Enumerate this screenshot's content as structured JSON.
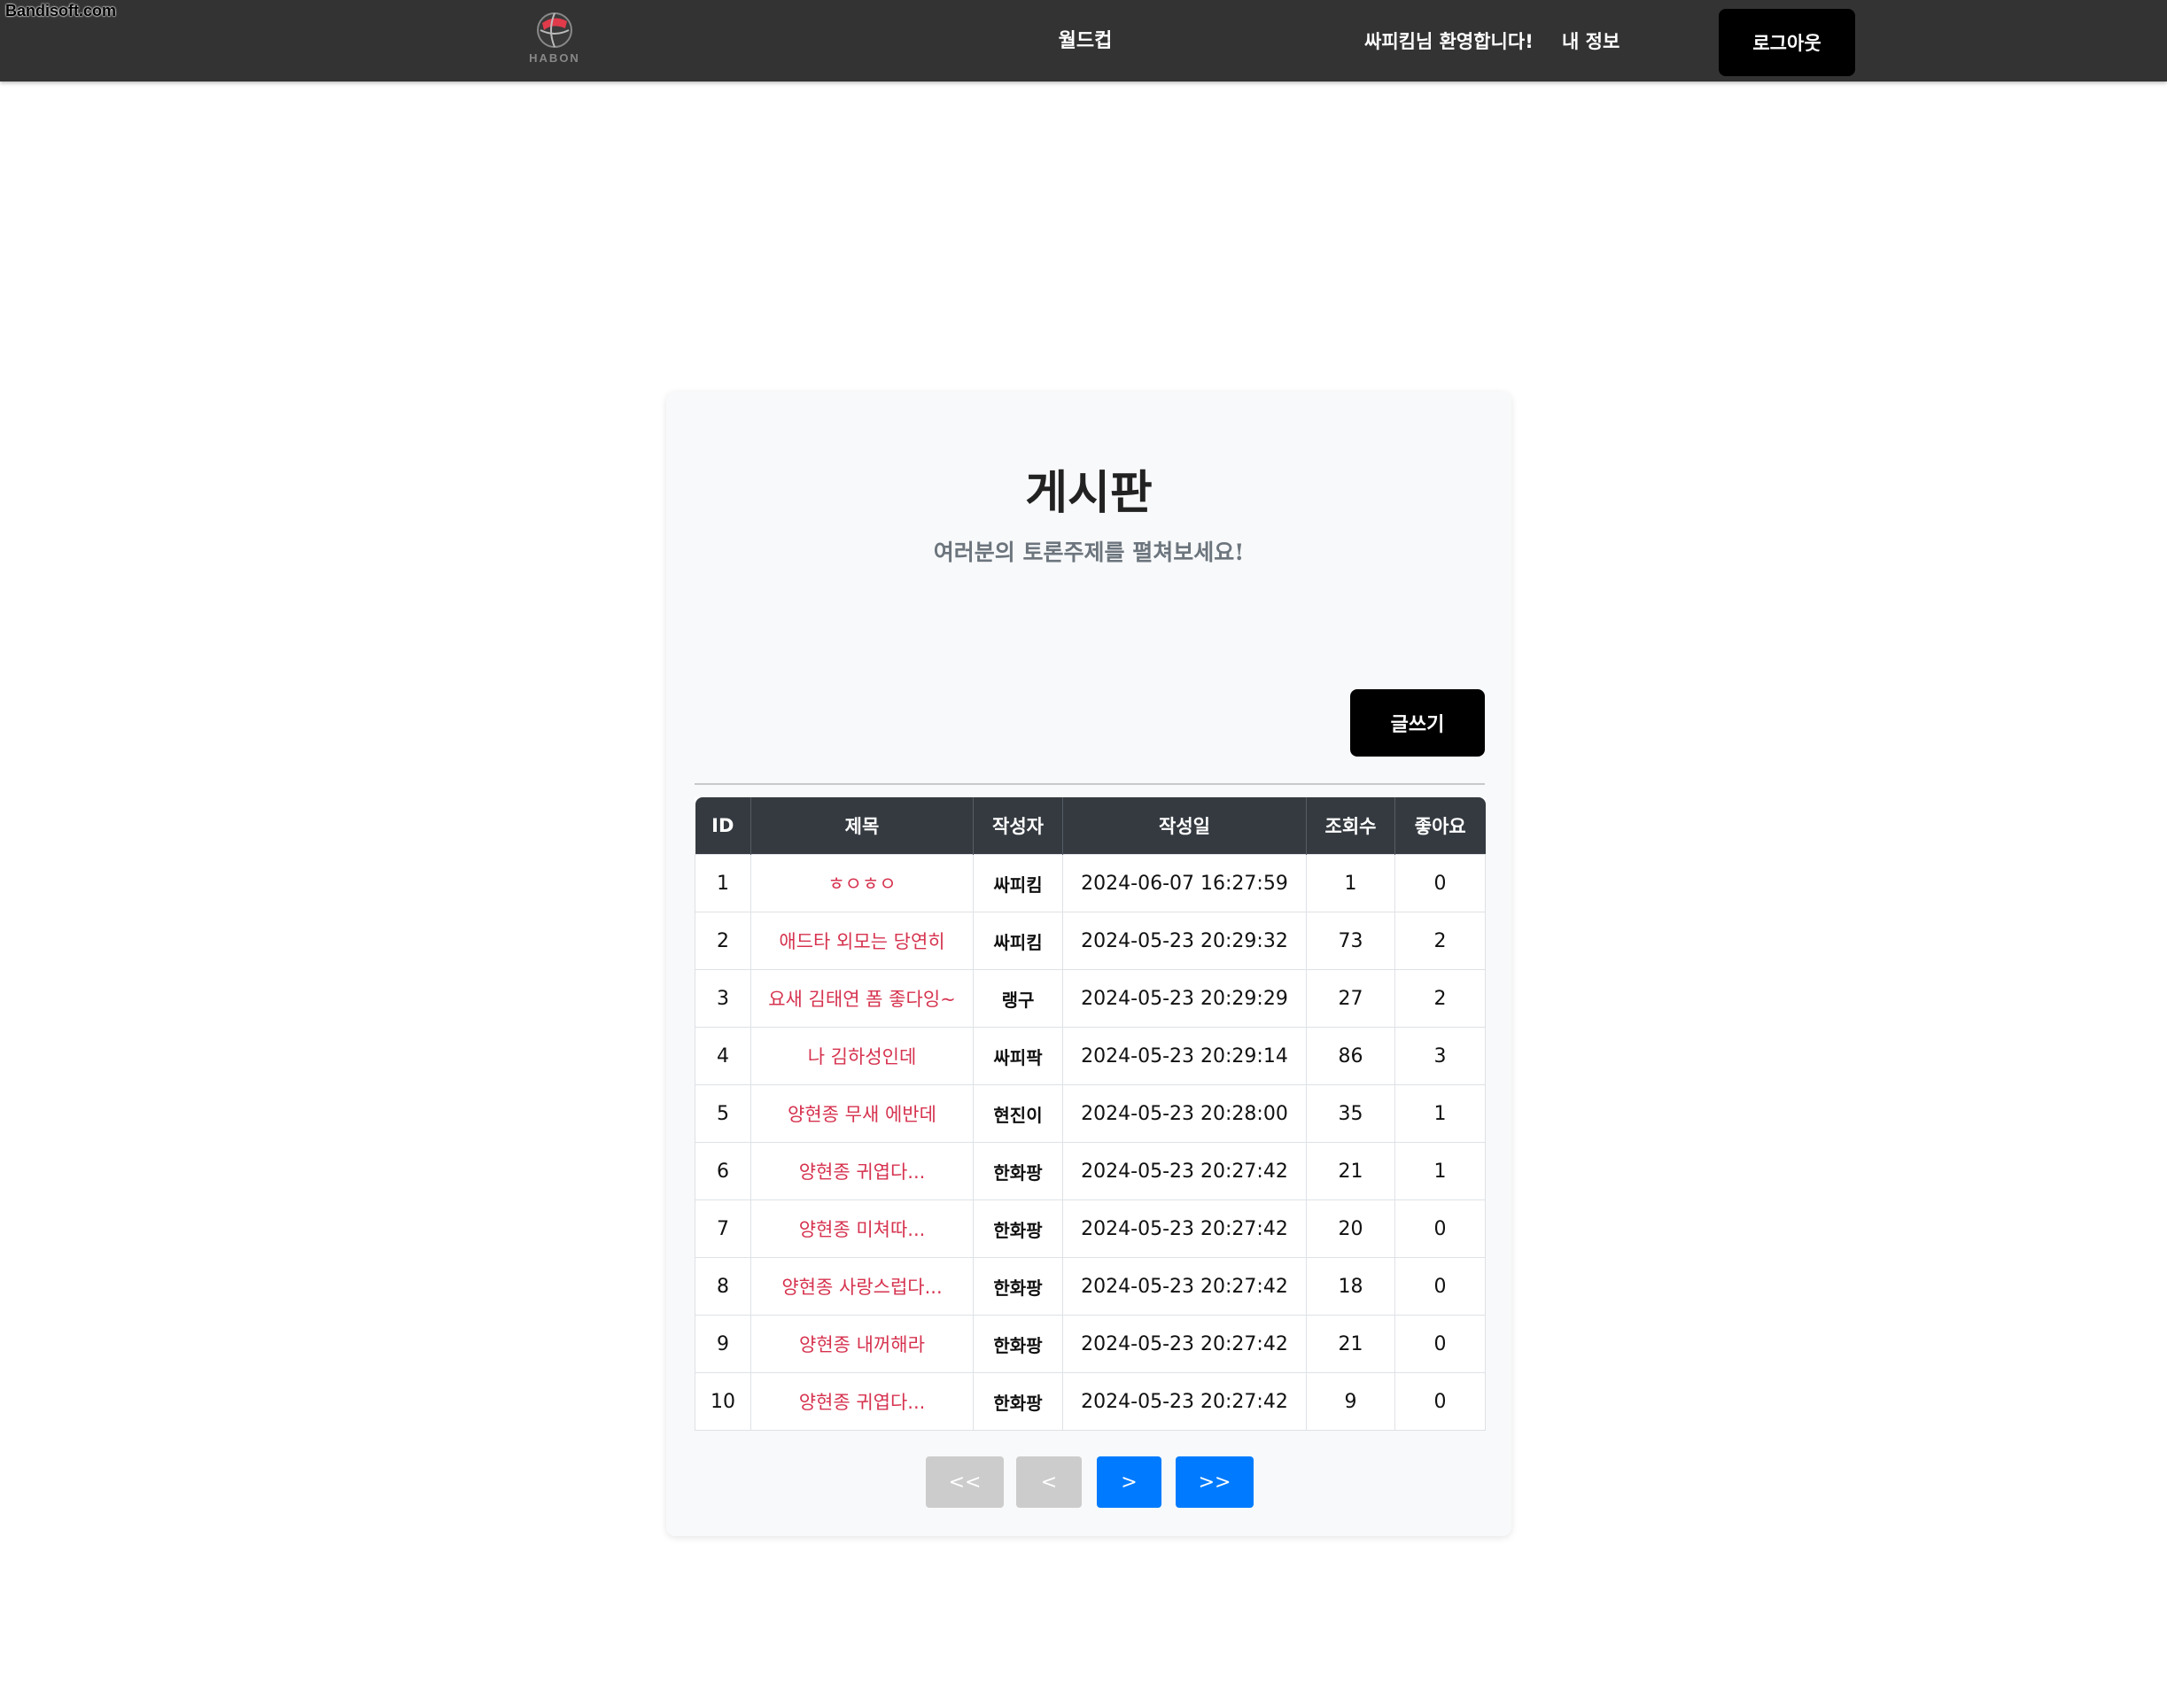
{
  "watermark": "Bandisoft.com",
  "navbar": {
    "logo_text": "HABON",
    "worldcup_label": "월드컵",
    "welcome_text": "싸피킴님 환영합니다!",
    "myinfo_label": "내 정보",
    "logout_label": "로그아웃"
  },
  "board": {
    "title": "게시판",
    "subtitle": "여러분의 토론주제를 펼쳐보세요!",
    "write_label": "글쓰기",
    "columns": [
      "ID",
      "제목",
      "작성자",
      "작성일",
      "조회수",
      "좋아요"
    ],
    "rows": [
      {
        "id": "1",
        "title": "ㅎㅇㅎㅇ",
        "author": "싸피킴",
        "date": "2024-06-07 16:27:59",
        "views": "1",
        "likes": "0"
      },
      {
        "id": "2",
        "title": "애드타 외모는 당연히",
        "author": "싸피킴",
        "date": "2024-05-23 20:29:32",
        "views": "73",
        "likes": "2"
      },
      {
        "id": "3",
        "title": "요새 김태연 폼 좋다잉~",
        "author": "랭구",
        "date": "2024-05-23 20:29:29",
        "views": "27",
        "likes": "2"
      },
      {
        "id": "4",
        "title": "나 김하성인데",
        "author": "싸피팍",
        "date": "2024-05-23 20:29:14",
        "views": "86",
        "likes": "3"
      },
      {
        "id": "5",
        "title": "양현종 무새 에반데",
        "author": "현진이",
        "date": "2024-05-23 20:28:00",
        "views": "35",
        "likes": "1"
      },
      {
        "id": "6",
        "title": "양현종 귀엽다...",
        "author": "한화팡",
        "date": "2024-05-23 20:27:42",
        "views": "21",
        "likes": "1"
      },
      {
        "id": "7",
        "title": "양현종 미쳐따...",
        "author": "한화팡",
        "date": "2024-05-23 20:27:42",
        "views": "20",
        "likes": "0"
      },
      {
        "id": "8",
        "title": "양현종 사랑스럽다...",
        "author": "한화팡",
        "date": "2024-05-23 20:27:42",
        "views": "18",
        "likes": "0"
      },
      {
        "id": "9",
        "title": "양현종 내꺼해라",
        "author": "한화팡",
        "date": "2024-05-23 20:27:42",
        "views": "21",
        "likes": "0"
      },
      {
        "id": "10",
        "title": "양현종 귀엽다...",
        "author": "한화팡",
        "date": "2024-05-23 20:27:42",
        "views": "9",
        "likes": "0"
      }
    ]
  },
  "pagination": {
    "first_label": "<<",
    "prev_label": "<",
    "next_label": ">",
    "last_label": ">>"
  },
  "colors": {
    "navbar_bg": "#333333",
    "title_link": "#d6334f",
    "page_active": "#007bff",
    "page_disabled": "#cccccc"
  },
  "icons": {
    "logo": "basketball-logo-icon"
  }
}
